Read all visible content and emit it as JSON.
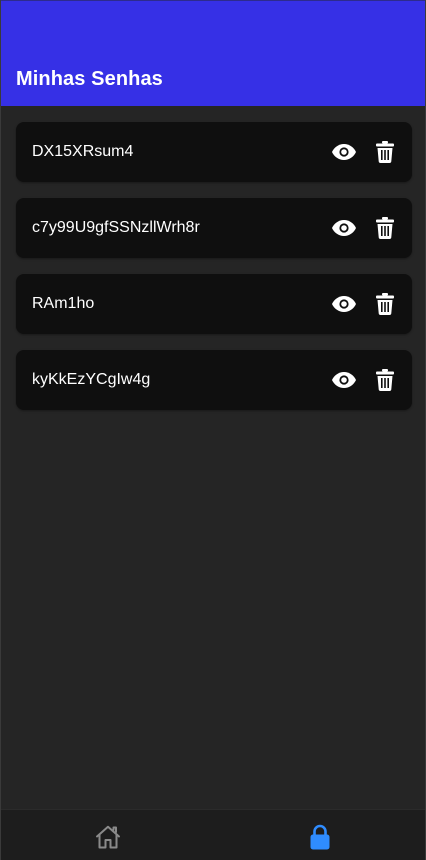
{
  "header": {
    "title": "Minhas Senhas",
    "background": "#3630e6"
  },
  "passwords": [
    {
      "value": "DX15XRsum4"
    },
    {
      "value": "c7y99U9gfSSNzllWrh8r"
    },
    {
      "value": "RAm1ho"
    },
    {
      "value": "kyKkEzYCgIw4g"
    }
  ],
  "card_actions": {
    "view_icon": "eye-icon",
    "delete_icon": "trash-icon"
  },
  "bottom_nav": {
    "items": [
      {
        "icon": "home-icon",
        "active": false,
        "color": "#8a8a8a"
      },
      {
        "icon": "lock-icon",
        "active": true,
        "color": "#2f8cff"
      }
    ]
  },
  "colors": {
    "background": "#252525",
    "card": "#0f0f0f",
    "text": "#ffffff",
    "accent": "#2f8cff"
  }
}
